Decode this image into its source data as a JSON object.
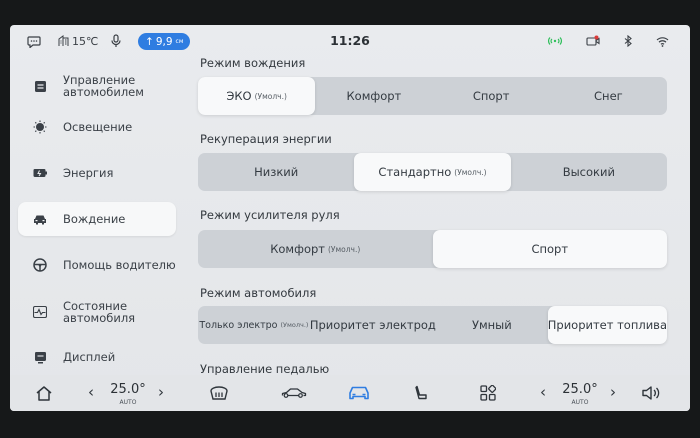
{
  "status_bar": {
    "outside_temp": "15℃",
    "cabin_temp_chip": "9,9",
    "cabin_temp_unit": "см",
    "time": "11:26"
  },
  "sidebar": {
    "items": [
      {
        "label": "Управление\nавтомобилем",
        "icon": "car-control-icon",
        "active": false
      },
      {
        "label": "Освещение",
        "icon": "light-icon",
        "active": false
      },
      {
        "label": "Энергия",
        "icon": "battery-icon",
        "active": false
      },
      {
        "label": "Вождение",
        "icon": "car-icon",
        "active": true
      },
      {
        "label": "Помощь водителю",
        "icon": "steering-wheel-icon",
        "active": false
      },
      {
        "label": "Состояние\nавтомобиля",
        "icon": "heartbeat-icon",
        "active": false
      },
      {
        "label": "Дисплей",
        "icon": "display-icon",
        "active": false
      }
    ]
  },
  "sections": [
    {
      "title": "Режим вождения",
      "options": [
        {
          "label": "ЭКО",
          "sub": "(Умолч.)",
          "selected": true
        },
        {
          "label": "Комфорт",
          "sub": "",
          "selected": false
        },
        {
          "label": "Спорт",
          "sub": "",
          "selected": false
        },
        {
          "label": "Снег",
          "sub": "",
          "selected": false
        }
      ]
    },
    {
      "title": "Рекуперация энергии",
      "options": [
        {
          "label": "Низкий",
          "sub": "",
          "selected": false
        },
        {
          "label": "Стандартно",
          "sub": "(Умолч.)",
          "selected": true
        },
        {
          "label": "Высокий",
          "sub": "",
          "selected": false
        }
      ]
    },
    {
      "title": "Режим усилителя руля",
      "options": [
        {
          "label": "Комфорт",
          "sub": "(Умолч.)",
          "selected": false
        },
        {
          "label": "Спорт",
          "sub": "",
          "selected": true
        }
      ]
    },
    {
      "title": "Режим автомобиля",
      "options": [
        {
          "label": "Только электро",
          "sub": "(Умолч.)",
          "selected": false
        },
        {
          "label": "Приоритет электрод",
          "sub": "",
          "selected": false
        },
        {
          "label": "Умный",
          "sub": "",
          "selected": false
        },
        {
          "label": "Приоритет топлива",
          "sub": "",
          "selected": true
        }
      ]
    },
    {
      "title": "Управление педалью",
      "options": []
    }
  ],
  "dock": {
    "left_climate": {
      "value": "25.0°",
      "mode": "AUTO"
    },
    "right_climate": {
      "value": "25.0°",
      "mode": "AUTO"
    },
    "icons": [
      "home-icon",
      "defrost-icon",
      "car-side-icon",
      "car-front-icon",
      "seat-icon",
      "apps-grid-icon",
      "volume-icon"
    ]
  },
  "colors": {
    "accent": "#2f7de1",
    "signal_green": "#2fbf5b",
    "record_red": "#d93b3b",
    "active_car_blue": "#2f7de1"
  }
}
